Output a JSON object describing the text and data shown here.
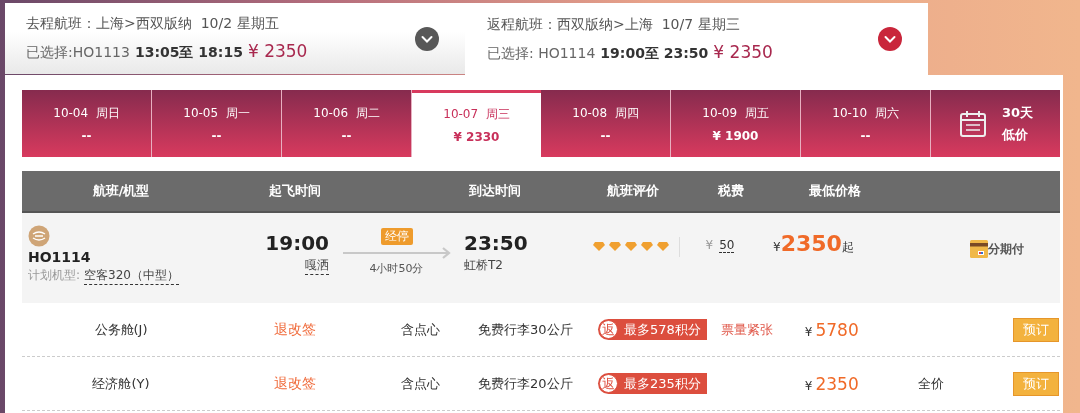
{
  "trips": [
    {
      "label": "去程航班：上海>西双版纳  10/2 星期五",
      "chosen_prefix": "已选择:HO1113",
      "times": "13:05至 18:15",
      "price": "¥ 2350",
      "selected": false
    },
    {
      "label": "返程航班：西双版纳>上海  10/7 星期三",
      "chosen_prefix": "已选择: HO1114",
      "times": "19:00至 23:50",
      "price": "¥ 2350",
      "selected": true
    }
  ],
  "date_tabs": [
    {
      "date": "10-04  周日",
      "price": "--",
      "selected": false
    },
    {
      "date": "10-05  周一",
      "price": "--",
      "selected": false
    },
    {
      "date": "10-06  周二",
      "price": "--",
      "selected": false
    },
    {
      "date": "10-07  周三",
      "price": "¥ 2330",
      "selected": true
    },
    {
      "date": "10-08  周四",
      "price": "--",
      "selected": false
    },
    {
      "date": "10-09  周五",
      "price": "¥ 1900",
      "selected": false
    },
    {
      "date": "10-10  周六",
      "price": "--",
      "selected": false
    }
  ],
  "calendar_tab": {
    "line1": "30天",
    "line2": "低价"
  },
  "columns": [
    "航班/机型",
    "起飞时间",
    "到达时间",
    "航班评价",
    "税费",
    "最低价格"
  ],
  "flight": {
    "number": "HO1114",
    "aircraft_label": "计划机型:",
    "aircraft": "空客320（中型）",
    "depart_time": "19:00",
    "depart_airport": "嘎洒",
    "stop_badge": "经停",
    "duration": "4小时50分",
    "arrive_time": "23:50",
    "arrive_airport": "虹桥T2",
    "stars": 5,
    "tax_currency": "¥",
    "tax": "50",
    "price_currency": "¥",
    "price": "2350",
    "price_suffix": "起",
    "installment": "分期付"
  },
  "cabins": [
    {
      "name": "公务舱(J)",
      "rules": "退改签",
      "meal": "含点心",
      "baggage": "免费行李30公斤",
      "rebate_icon": "返",
      "rebate": "最多578积分",
      "availability": "票量紧张",
      "currency": "¥",
      "price": "5780",
      "button": "预订"
    },
    {
      "name": "经济舱(Y)",
      "rules": "退改签",
      "meal": "含点心",
      "baggage": "免费行李20公斤",
      "rebate_icon": "返",
      "rebate": "最多235积分",
      "currency": "¥",
      "price": "2350",
      "fare_note": "全价",
      "button": "预订"
    }
  ]
}
